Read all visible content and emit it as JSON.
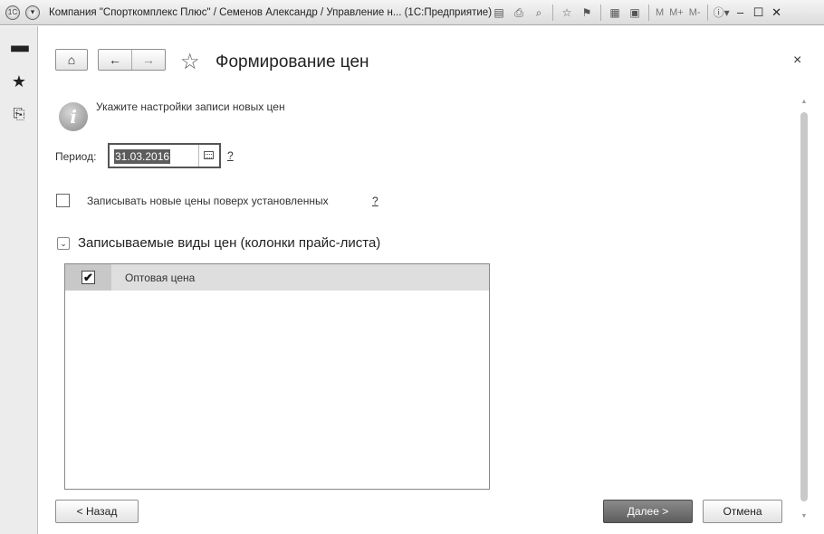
{
  "window": {
    "title": "Компания \"Спорткомплекс Плюс\" / Семенов Александр / Управление н...  (1С:Предприятие)",
    "logo_icon": "1c-logo-icon",
    "menu_icon": "main-menu-icon",
    "tools": [
      "save-icon",
      "print-icon",
      "preview-icon",
      "favorite-add-icon",
      "bookmark-icon",
      "calculator-icon",
      "calendar-icon"
    ],
    "memory_buttons": [
      "M",
      "M+",
      "M-"
    ],
    "info_icon": "info-icon",
    "minimize": "–",
    "maximize": "☐",
    "close": "✕"
  },
  "left_panel": {
    "items": [
      {
        "icon": "apps-grid-icon",
        "glyph": "⋮⋮⋮"
      },
      {
        "icon": "favorites-star-icon",
        "glyph": "★"
      },
      {
        "icon": "history-icon",
        "glyph": "⎘"
      }
    ]
  },
  "form": {
    "home_glyph": "⌂",
    "back_glyph": "←",
    "forward_glyph": "→",
    "favorite_glyph": "☆",
    "title": "Формирование цен",
    "close_glyph": "×",
    "info_text": "Укажите настройки записи новых цен",
    "period_label": "Период:",
    "period_value": "31.03.2016",
    "help_mark": "?",
    "overwrite_label": "Записывать новые цены поверх установленных",
    "overwrite_checked": false,
    "group_title": "Записываемые виды цен (колонки прайс-листа)",
    "group_toggle": "⌄",
    "price_types": [
      {
        "name": "Оптовая цена",
        "checked": true,
        "check_glyph": "✔"
      }
    ],
    "back_button": "< Назад",
    "next_button": "Далее >",
    "cancel_button": "Отмена"
  }
}
